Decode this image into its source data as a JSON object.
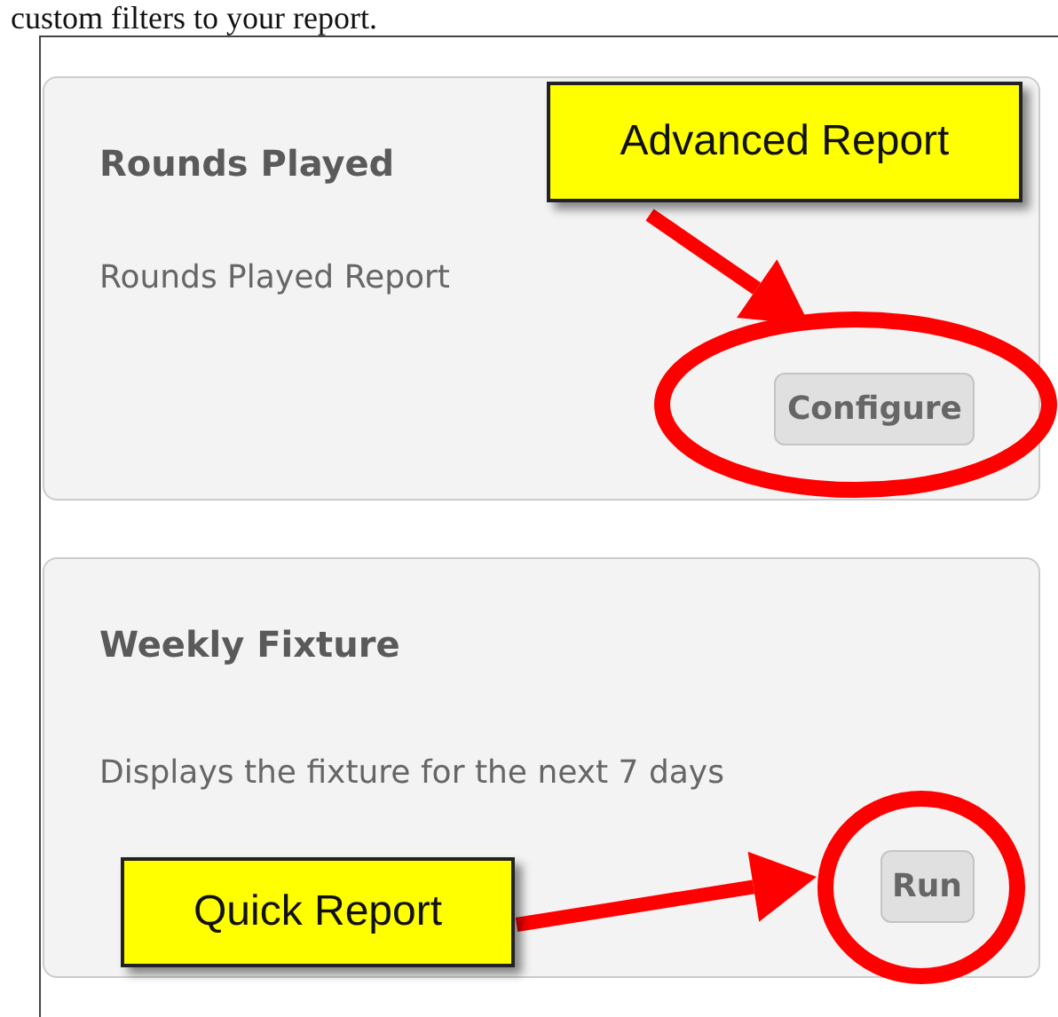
{
  "intro": "custom filters to your report.",
  "reports": [
    {
      "title": "Rounds Played",
      "description": "Rounds Played Report",
      "button": "Configure"
    },
    {
      "title": "Weekly Fixture",
      "description": "Displays the fixture for the next 7 days",
      "button": "Run"
    }
  ],
  "callouts": [
    "Advanced Report",
    "Quick Report"
  ]
}
